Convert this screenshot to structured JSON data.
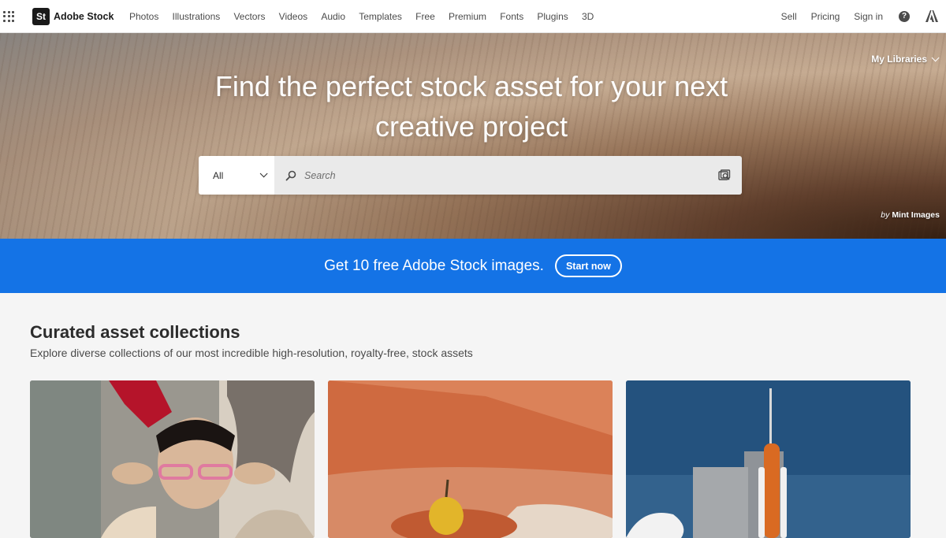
{
  "nav": {
    "logo_badge": "St",
    "logo_text": "Adobe Stock",
    "links": [
      "Photos",
      "Illustrations",
      "Vectors",
      "Videos",
      "Audio",
      "Templates",
      "Free",
      "Premium",
      "Fonts",
      "Plugins",
      "3D"
    ],
    "right": {
      "sell": "Sell",
      "pricing": "Pricing",
      "signin": "Sign in",
      "help": "?"
    }
  },
  "hero": {
    "my_libraries": "My Libraries",
    "title_line1": "Find the perfect stock asset for your next",
    "title_line2": "creative project",
    "search": {
      "category": "All",
      "placeholder": "Search"
    },
    "credit_by": "by",
    "credit_name": "Mint Images"
  },
  "promo": {
    "text": "Get 10 free Adobe Stock images.",
    "button": "Start now"
  },
  "collections": {
    "title": "Curated asset collections",
    "subtitle": "Explore diverse collections of our most incredible high-resolution, royalty-free, stock assets"
  },
  "colors": {
    "brand_blue": "#1473e6",
    "nav_text": "#4b4b4b"
  }
}
